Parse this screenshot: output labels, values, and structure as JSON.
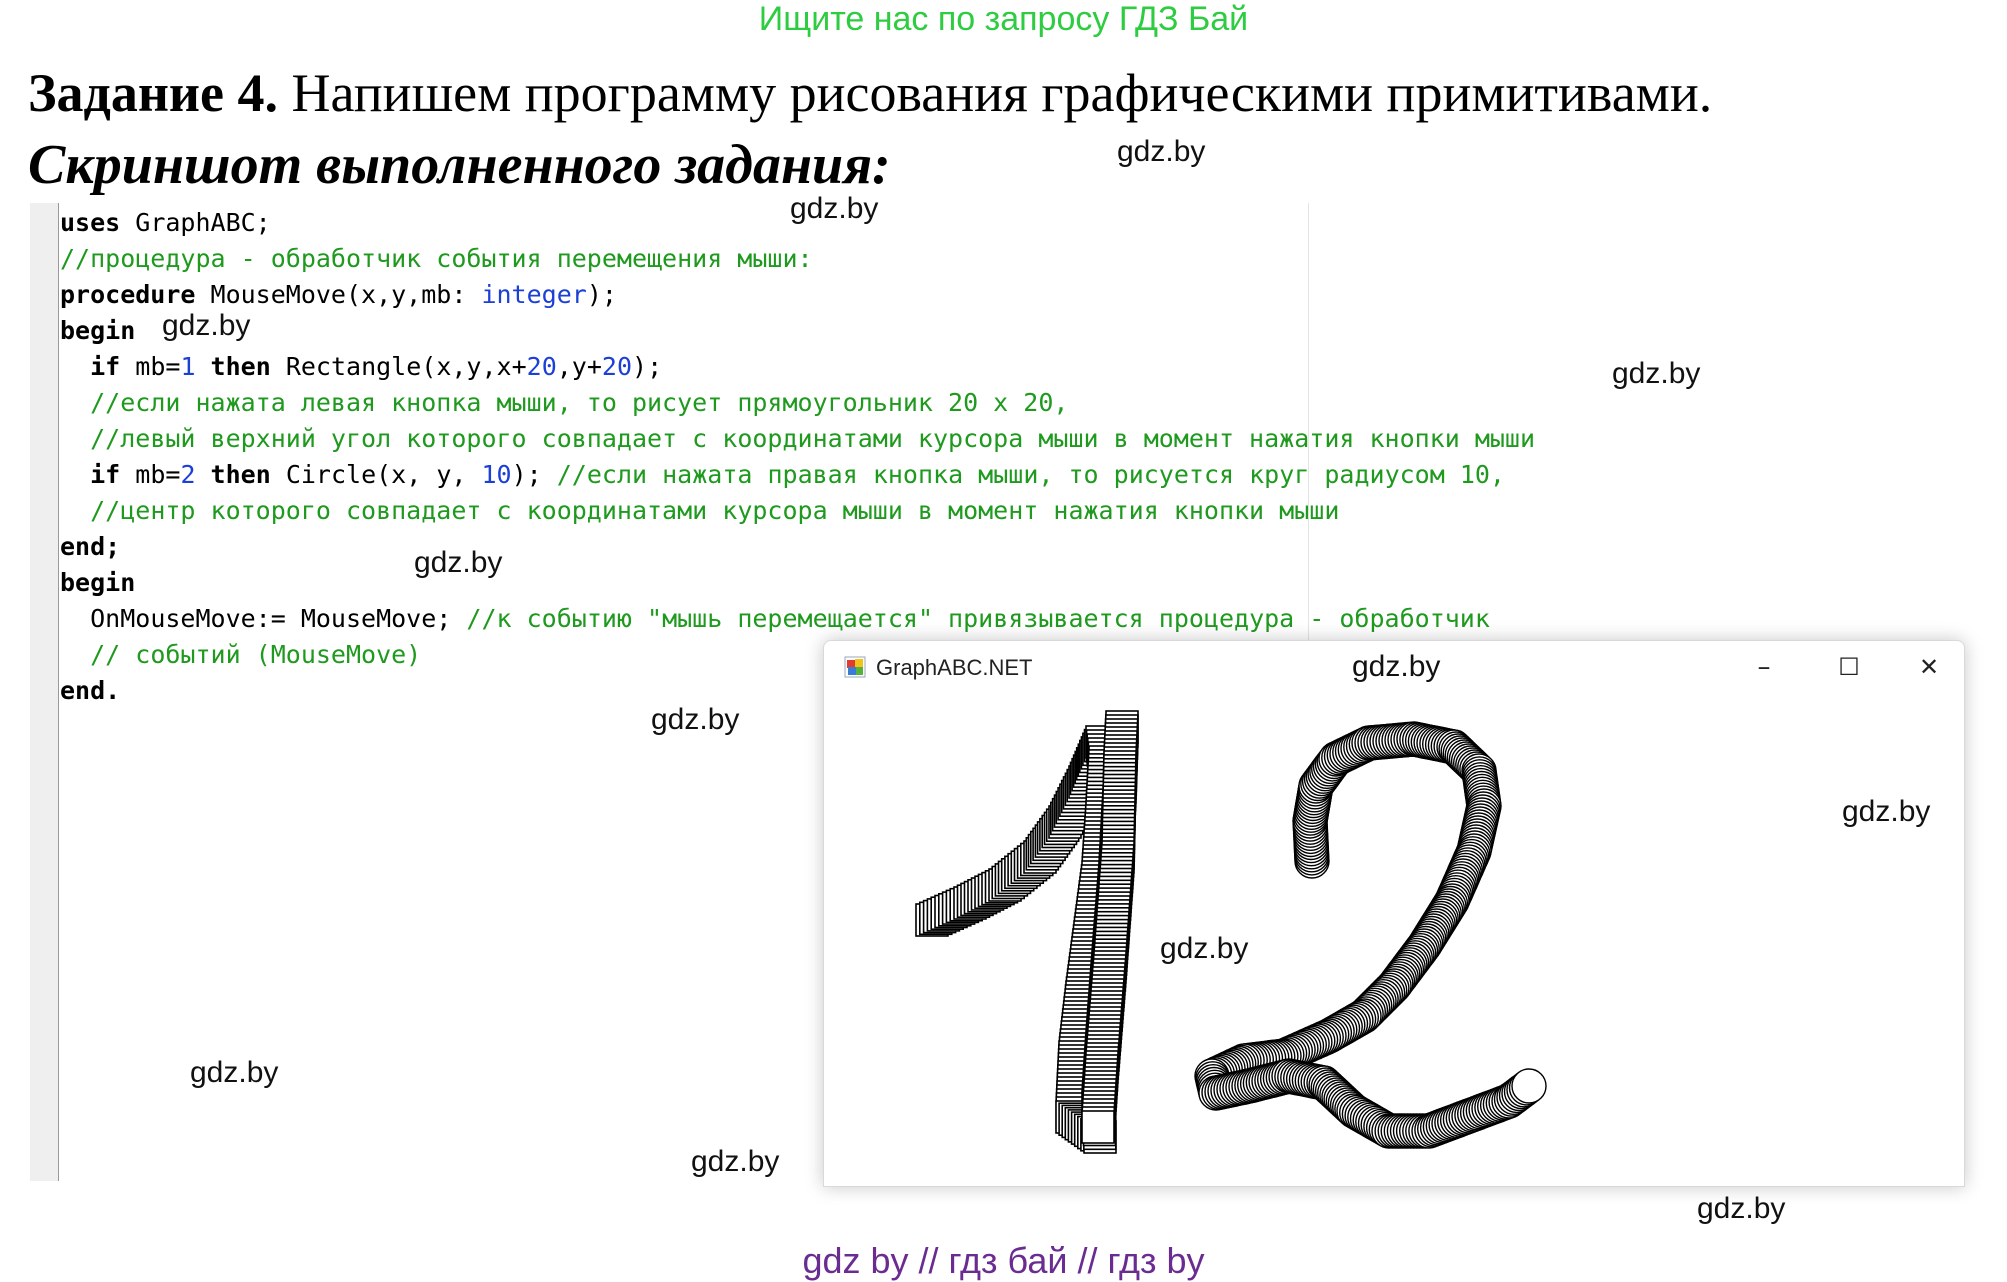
{
  "top_banner": "Ищите нас по запросу ГДЗ Бай",
  "task": {
    "label": "Задание 4.",
    "text": "Напишем программу рисования графическими примитивами."
  },
  "screenshot_heading": "Скриншот выполненного задания:",
  "code": {
    "l1": {
      "kw": "uses",
      "rest": " GraphABC;"
    },
    "l2": {
      "comment": "//процедура - обработчик события перемещения мыши:"
    },
    "l3": {
      "kw": "procedure",
      "a": " MouseMove(x,y,mb: ",
      "type": "integer",
      "b": ");"
    },
    "l4": {
      "kw": "begin"
    },
    "l5": {
      "kw1": "if",
      "a": " mb=",
      "n1": "1",
      "kw2": " then",
      "b": " Rectangle(x,y,x+",
      "n2": "20",
      "c": ",y+",
      "n3": "20",
      "d": ");"
    },
    "l6": {
      "comment": "//если нажата левая кнопка мыши, то рисует прямоугольник 20 x 20,"
    },
    "l7": {
      "comment": "//левый верхний угол которого совпадает с координатами курсора мыши в момент нажатия кнопки мыши"
    },
    "l8": {
      "kw1": "if",
      "a": " mb=",
      "n1": "2",
      "kw2": " then",
      "b": " Circle(x, y, ",
      "n2": "10",
      "c": "); ",
      "comment": "//если нажата правая кнопка мыши, то рисуется круг радиусом 10,"
    },
    "l9": {
      "comment": "//центр которого совпадает с координатами курсора мыши в момент нажатия кнопки мыши"
    },
    "l10": {
      "kw": "end;"
    },
    "l11": {
      "kw": "begin"
    },
    "l12": {
      "a": "OnMouseMove:= MouseMove; ",
      "comment": "//к событию \"мышь перемещается\" привязывается процедура - обработчик"
    },
    "l13": {
      "comment": "// событий (MouseMove)"
    },
    "l14": {
      "kw": "end."
    }
  },
  "graph_window": {
    "title": "GraphABC.NET",
    "minimize": "–",
    "maximize": "☐",
    "close": "✕",
    "app_icon": "graphabc-app-icon"
  },
  "drawing": {
    "digits": [
      "1",
      "2"
    ],
    "shape_1": "rectangle 20 x 20",
    "shape_2": "circle radius 10"
  },
  "watermark": "gdz.by",
  "footer": "gdz by  //  гдз бай  //  гдз by",
  "colors": {
    "banner": "#2ecc40",
    "comment": "#1f9a1f",
    "type": "#1c3fd6",
    "footer": "#6a2c91"
  }
}
